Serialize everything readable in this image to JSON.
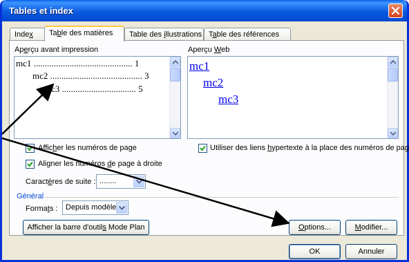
{
  "window": {
    "title": "Tables et index",
    "close_label": "close"
  },
  "tabs": [
    {
      "label_pre": "Inde",
      "label_u": "x",
      "label_post": ""
    },
    {
      "label_pre": "Ta",
      "label_u": "b",
      "label_post": "le des matières"
    },
    {
      "label_pre": "Table des ",
      "label_u": "i",
      "label_post": "llustrations"
    },
    {
      "label_pre": "T",
      "label_u": "a",
      "label_post": "ble des références"
    }
  ],
  "print_preview": {
    "label_pre": "Ap",
    "label_u": "e",
    "label_post": "rçu avant impression",
    "lines": [
      {
        "text": "mc1 ............................................ 1"
      },
      {
        "text": "mc2 ......................................... 3"
      },
      {
        "text": "mc3 ................................. 5"
      }
    ]
  },
  "web_preview": {
    "label_pre": "Aperçu ",
    "label_u": "W",
    "label_post": "eb",
    "links": [
      "mc1",
      "mc2",
      "mc3"
    ]
  },
  "options": {
    "show_page_numbers": {
      "pre": "Affic",
      "u": "h",
      "post": "er les numéros de page",
      "checked": true
    },
    "align_right": {
      "pre": "Aligner les numéros ",
      "u": "d",
      "post": "e page à droite",
      "checked": true
    },
    "hyperlinks": {
      "pre": "Utiliser des liens ",
      "u": "h",
      "post": "ypertexte à la place des numéros de page",
      "checked": true
    },
    "tab_leader": {
      "pre": "Caract",
      "u": "è",
      "post": "res de suite :",
      "value": "........"
    }
  },
  "general": {
    "heading": "Général",
    "formats_pre": "Forma",
    "formats_u": "t",
    "formats_post": "s :",
    "formats_value": "Depuis modèle"
  },
  "buttons": {
    "outline_pre": "Afficher la barre d'outil",
    "outline_u": "s",
    "outline_post": " Mode Plan",
    "options_pre": "",
    "options_u": "O",
    "options_post": "ptions...",
    "modify_pre": "",
    "modify_u": "M",
    "modify_post": "odifier...",
    "ok": "OK",
    "cancel": "Annuler"
  },
  "colors": {
    "titlebar": "#0054e3",
    "link": "#0000ee",
    "dialog_bg": "#ece9d8",
    "accent_tab": "#ffc83c",
    "arrow": "#000000"
  }
}
